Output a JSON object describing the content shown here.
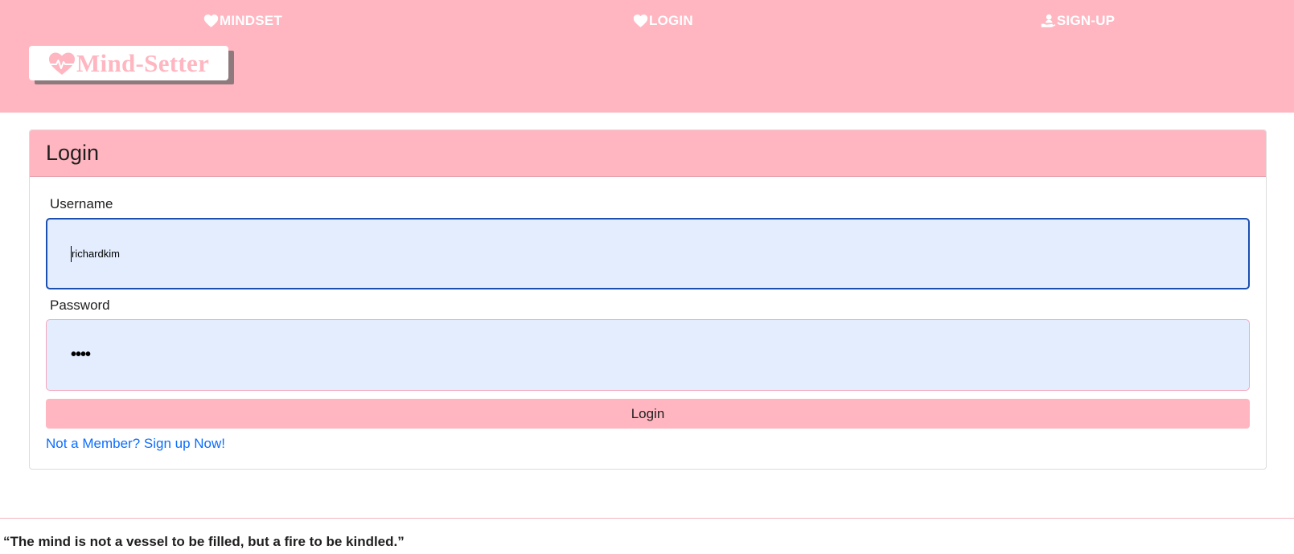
{
  "nav": {
    "mindset_label": "MINDSET",
    "login_label": "LOGIN",
    "signup_label": "SIGN-UP"
  },
  "logo": {
    "text": "Mind-Setter",
    "icon": "heart-pulse-icon"
  },
  "login_card": {
    "title": "Login",
    "username_label": "Username",
    "username_value": "richardkim",
    "password_label": "Password",
    "password_value": "••••",
    "submit_label": "Login",
    "signup_link": "Not a Member? Sign up Now!"
  },
  "footer": {
    "quote": "“The mind is not a vessel to be filled, but a fire to be kindled.”"
  },
  "colors": {
    "brand_pink": "#ffb6c1",
    "link_blue": "#0d6efd",
    "input_bg": "#e4edfe",
    "focus_border": "#1b4fb0"
  }
}
